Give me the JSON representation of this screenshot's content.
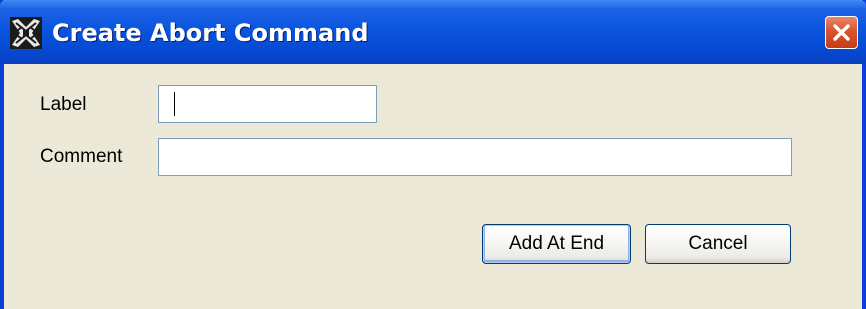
{
  "window": {
    "title": "Create Abort Command",
    "app_icon": "app-icon",
    "close_icon": "close-icon"
  },
  "form": {
    "label_caption": "Label",
    "label_value": "",
    "comment_caption": "Comment",
    "comment_value": ""
  },
  "buttons": {
    "add_at_end": "Add At End",
    "cancel": "Cancel"
  },
  "colors": {
    "titlebar": "#0a55df",
    "window_background": "#ece9d8",
    "close_button": "#d9532f",
    "input_border": "#7f9db9"
  }
}
